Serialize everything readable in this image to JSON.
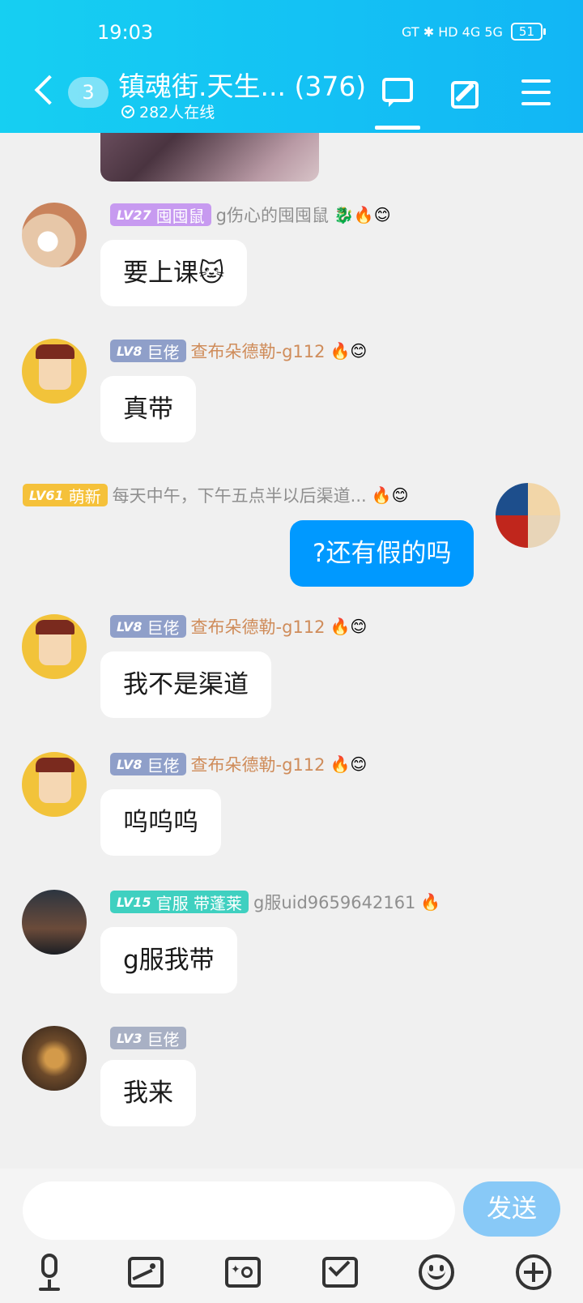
{
  "status_bar": {
    "time": "19:03",
    "network": "GT ✱ HD 4G 5G",
    "battery": "51"
  },
  "header": {
    "unread_count": "3",
    "title": "镇魂街.天生... (376)",
    "online": "282人在线"
  },
  "chat": {
    "messages": [
      {
        "level": "LV27",
        "title": "囤囤鼠",
        "nickname": "g伤心的囤囤鼠",
        "emoji": "🐉🔥😊",
        "text": "要上课🐱"
      },
      {
        "level": "LV8",
        "title": "巨佬",
        "nickname": "查布朵德勒-g112",
        "emoji": "🔥😊",
        "text": "真带"
      },
      {
        "level": "LV61",
        "title": "萌新",
        "nickname": "每天中午，下午五点半以后渠道...",
        "emoji": "🔥😊",
        "text": "?还有假的吗"
      },
      {
        "level": "LV8",
        "title": "巨佬",
        "nickname": "查布朵德勒-g112",
        "emoji": "🔥😊",
        "text": "我不是渠道"
      },
      {
        "level": "LV8",
        "title": "巨佬",
        "nickname": "查布朵德勒-g112",
        "emoji": "🔥😊",
        "text": "呜呜呜"
      },
      {
        "level": "LV15",
        "title": "官服 带蓬莱",
        "nickname": "g服uid9659642161",
        "emoji": "🔥",
        "text": "g服我带"
      },
      {
        "level": "LV3",
        "title": "巨佬",
        "nickname": "",
        "emoji": "",
        "text": "我来"
      }
    ]
  },
  "input": {
    "placeholder": "",
    "send_label": "发送"
  },
  "colors": {
    "header": "#16cff2",
    "my_bubble": "#0099ff",
    "send_button": "#88c9f7"
  }
}
